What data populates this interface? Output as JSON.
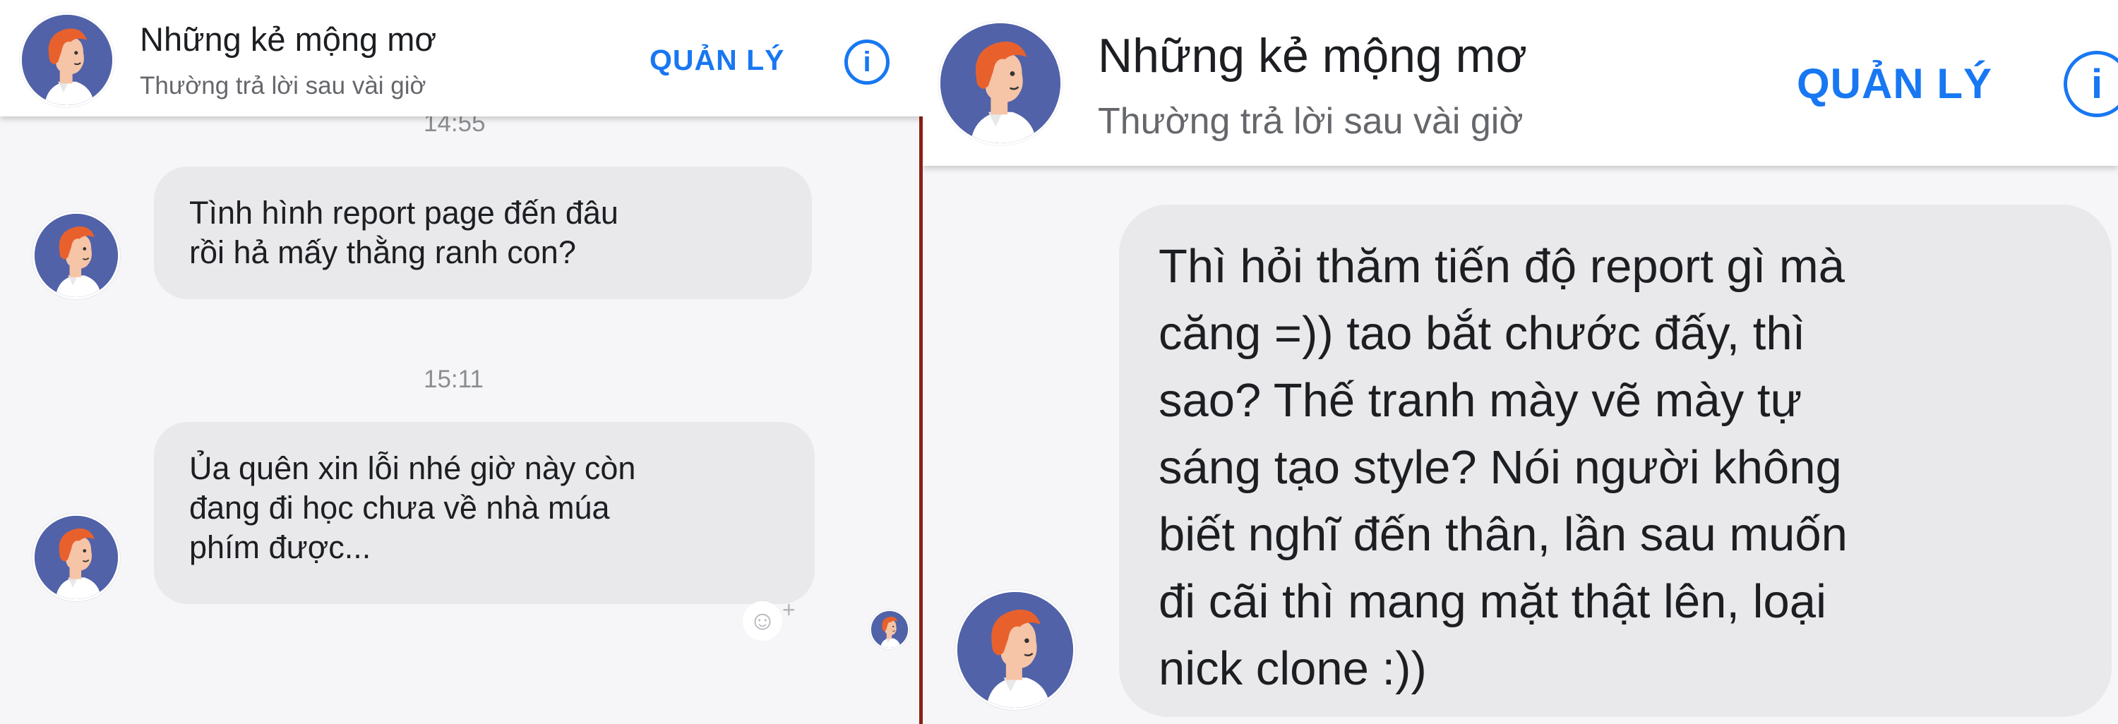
{
  "conversation": {
    "name": "Những kẻ mộng mơ",
    "status": "Thường trả lời sau vài giờ",
    "manage_label": "QUẢN LÝ",
    "info_icon": "i",
    "avatar": "group-avatar-illustration"
  },
  "left_panel": {
    "partial_timestamp": "14:55",
    "messages": [
      {
        "lines": [
          "Tình hình report page đến đâu",
          "rồi hả mấy thằng ranh con?"
        ]
      },
      {
        "timestamp": "15:11"
      },
      {
        "lines": [
          "Ủa quên xin lỗi nhé giờ này còn",
          "đang đi học chưa về nhà múa",
          "phím được..."
        ]
      }
    ],
    "reaction_icon": "☺",
    "reaction_plus": "+"
  },
  "right_panel": {
    "messages": [
      {
        "lines": [
          "Thì hỏi thăm tiến độ report gì mà",
          "căng =)) tao bắt chước đấy, thì",
          "sao? Thế tranh mày vẽ mày tự",
          "sáng tạo style? Nói người không",
          "biết nghĩ đến thân, lần sau muốn",
          "đi cãi thì mang mặt thật lên, loại",
          "nick clone :))"
        ]
      }
    ]
  },
  "colors": {
    "accent": "#1877f2",
    "bubble": "#e9e9ec",
    "background": "#f6f6f8",
    "avatar_bg": "#5162a8"
  }
}
